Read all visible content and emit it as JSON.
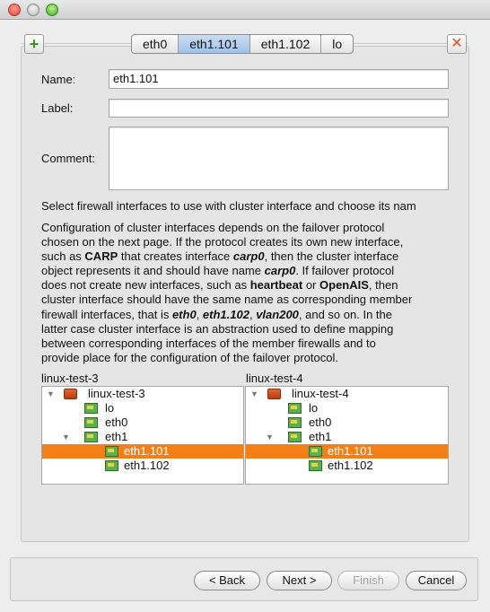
{
  "tabs": [
    "eth0",
    "eth1.101",
    "eth1.102",
    "lo"
  ],
  "active_tab_index": 1,
  "form": {
    "name_label": "Name:",
    "name_value": "eth1.101",
    "label_label": "Label:",
    "label_value": "",
    "comment_label": "Comment:",
    "comment_value": ""
  },
  "instruction": "Select firewall interfaces to use with cluster interface and choose its nam",
  "description": [
    [
      {
        "t": "Configuration of cluster interfaces depends on the failover protocol"
      }
    ],
    [
      {
        "t": "chosen on the next page. If the protocol creates its own new interface,"
      }
    ],
    [
      {
        "t": "such as "
      },
      {
        "t": "CARP",
        "b": 1
      },
      {
        "t": " that creates interface "
      },
      {
        "t": "carp0",
        "b": 1,
        "i": 1
      },
      {
        "t": ", then the cluster interface"
      }
    ],
    [
      {
        "t": "object represents it and should have name "
      },
      {
        "t": "carp0",
        "b": 1,
        "i": 1
      },
      {
        "t": ". If failover protocol"
      }
    ],
    [
      {
        "t": "does not create new interfaces, such as "
      },
      {
        "t": "heartbeat",
        "b": 1
      },
      {
        "t": " or "
      },
      {
        "t": "OpenAIS",
        "b": 1
      },
      {
        "t": ", then"
      }
    ],
    [
      {
        "t": "cluster interface should have the same name as corresponding member"
      }
    ],
    [
      {
        "t": "firewall interfaces, that is "
      },
      {
        "t": "eth0",
        "b": 1,
        "i": 1
      },
      {
        "t": ", "
      },
      {
        "t": "eth1.102",
        "b": 1,
        "i": 1
      },
      {
        "t": ", "
      },
      {
        "t": "vlan200",
        "b": 1,
        "i": 1
      },
      {
        "t": ", and so on. In the"
      }
    ],
    [
      {
        "t": "latter case cluster interface is an abstraction used to define mapping"
      }
    ],
    [
      {
        "t": "between corresponding interfaces of the member firewalls and to"
      }
    ],
    [
      {
        "t": "provide place for the configuration of the failover protocol."
      }
    ]
  ],
  "trees": [
    {
      "title": "linux-test-3",
      "rows": [
        {
          "label": "linux-test-3",
          "level": 0,
          "icon": "host-icon",
          "expanded": true,
          "selected": false
        },
        {
          "label": "lo",
          "level": 1,
          "icon": "nic-icon",
          "expanded": null,
          "selected": false
        },
        {
          "label": "eth0",
          "level": 1,
          "icon": "nic-icon",
          "expanded": null,
          "selected": false
        },
        {
          "label": "eth1",
          "level": 1,
          "icon": "nic-icon",
          "expanded": true,
          "selected": false
        },
        {
          "label": "eth1.101",
          "level": 2,
          "icon": "nic-icon",
          "expanded": null,
          "selected": true
        },
        {
          "label": "eth1.102",
          "level": 2,
          "icon": "nic-icon",
          "expanded": null,
          "selected": false
        }
      ]
    },
    {
      "title": "linux-test-4",
      "rows": [
        {
          "label": "linux-test-4",
          "level": 0,
          "icon": "host-icon",
          "expanded": true,
          "selected": false
        },
        {
          "label": "lo",
          "level": 1,
          "icon": "nic-icon",
          "expanded": null,
          "selected": false
        },
        {
          "label": "eth0",
          "level": 1,
          "icon": "nic-icon",
          "expanded": null,
          "selected": false
        },
        {
          "label": "eth1",
          "level": 1,
          "icon": "nic-icon",
          "expanded": true,
          "selected": false
        },
        {
          "label": "eth1.101",
          "level": 2,
          "icon": "nic-icon",
          "expanded": null,
          "selected": true
        },
        {
          "label": "eth1.102",
          "level": 2,
          "icon": "nic-icon",
          "expanded": null,
          "selected": false
        }
      ]
    }
  ],
  "buttons": {
    "back": "< Back",
    "next": "Next >",
    "finish": "Finish",
    "cancel": "Cancel",
    "finish_enabled": false
  },
  "colors": {
    "selection": "#f47f16",
    "active_tab": "#a9c8ec"
  }
}
